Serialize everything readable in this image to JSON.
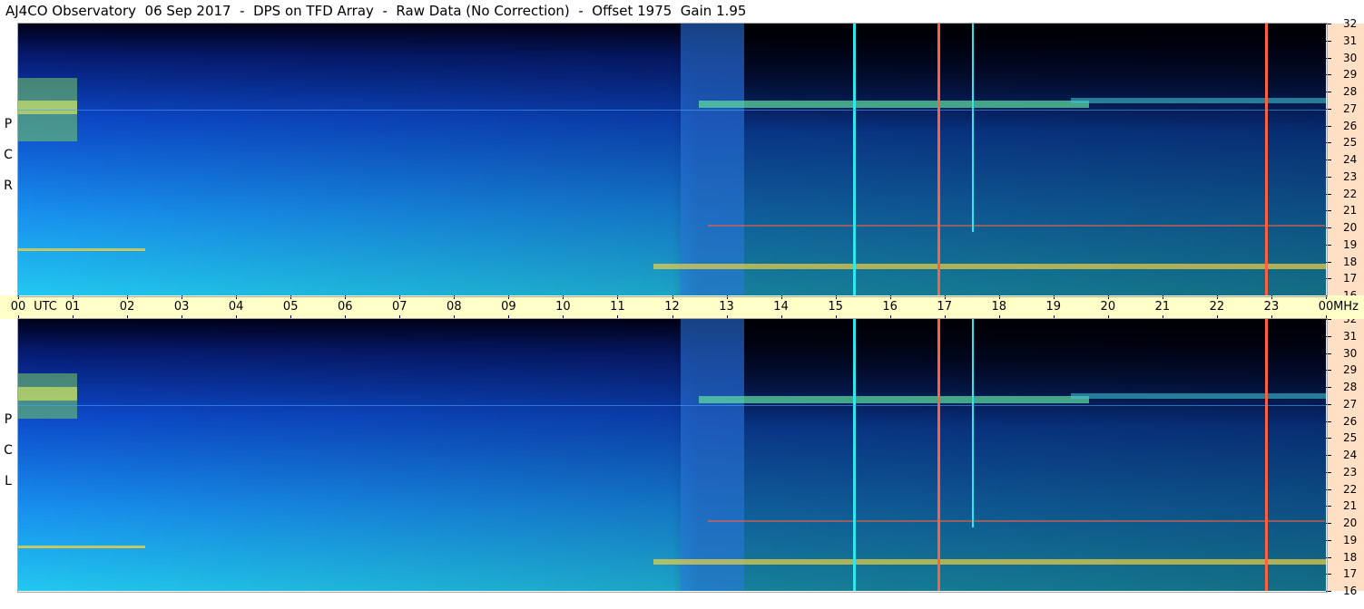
{
  "title": "AJ4CO Observatory  06 Sep 2017  -  DPS on TFD Array  -  Raw Data (No Correction)  -  Offset 1975  Gain 1.95",
  "panels": [
    {
      "id": "rcp",
      "label_letters": [
        "R",
        "C",
        "P"
      ]
    },
    {
      "id": "lcp",
      "label_letters": [
        "L",
        "C",
        "P"
      ]
    }
  ],
  "colors": {
    "background_dark": "#000010",
    "quiet_sky": "#1a64e6",
    "warm_band": "#ffe0c4",
    "time_band": "#ffffc8",
    "interference_line": "#ff6040",
    "cyan_line": "#2ee8f0"
  },
  "chart_data": {
    "type": "heatmap",
    "title": "AJ4CO Observatory  06 Sep 2017  -  DPS on TFD Array  -  Raw Data (No Correction)  -  Offset 1975  Gain 1.95",
    "x_unit": "UTC",
    "y_unit": "MHz",
    "xlim": [
      0,
      24
    ],
    "ylim": [
      16,
      32
    ],
    "x_tick_labels": [
      "00",
      "01",
      "02",
      "03",
      "04",
      "05",
      "06",
      "07",
      "08",
      "09",
      "10",
      "11",
      "12",
      "13",
      "14",
      "15",
      "16",
      "17",
      "18",
      "19",
      "20",
      "21",
      "22",
      "23",
      "00"
    ],
    "y_tick_labels": [
      "32",
      "31",
      "30",
      "29",
      "28",
      "27",
      "26",
      "25",
      "24",
      "23",
      "22",
      "21",
      "20",
      "19",
      "18",
      "17",
      "16"
    ],
    "series": [
      {
        "name": "RCP",
        "vertical_interference_utc": [
          12.0,
          12.3,
          12.5,
          15.45,
          16.9,
          17.55,
          22.95
        ],
        "horizontal_bands_mhz": [
          17.5,
          20.0,
          27.0
        ]
      },
      {
        "name": "LCP",
        "vertical_interference_utc": [
          12.0,
          12.3,
          12.5,
          15.45,
          16.9,
          17.55,
          22.95
        ],
        "horizontal_bands_mhz": [
          17.5,
          20.0,
          27.0
        ]
      }
    ]
  }
}
